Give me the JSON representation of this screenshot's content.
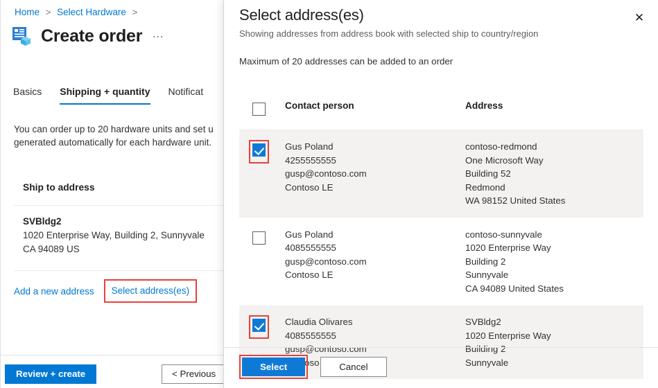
{
  "background_page": {
    "breadcrumb": {
      "home": "Home",
      "second": "Select Hardware",
      "separator": ">"
    },
    "title": "Create order",
    "more_label": "…",
    "tabs": [
      {
        "label": "Basics",
        "active": false
      },
      {
        "label": "Shipping + quantity",
        "active": true
      },
      {
        "label": "Notificat",
        "active": false
      }
    ],
    "body_line1": "You can order up to 20 hardware units and set u",
    "body_line2": "generated automatically for each hardware unit.",
    "section_heading": "Ship to address",
    "address": {
      "name": "SVBldg2",
      "line1": "1020 Enterprise Way, Building 2, Sunnyvale",
      "line2": "CA 94089 US"
    },
    "links": {
      "add_new_address": "Add a new address",
      "select_addresses": "Select address(es)"
    },
    "footer": {
      "review_create": "Review + create",
      "previous": "< Previous"
    }
  },
  "dialog": {
    "title": "Select address(es)",
    "subtitle": "Showing addresses from address book with selected ship to country/region",
    "note": "Maximum of 20 addresses can be added to an order",
    "close_label": "✕",
    "table": {
      "select_all_checked": false,
      "headers": {
        "contact_person": "Contact person",
        "address": "Address"
      },
      "rows": [
        {
          "checked": true,
          "highlighted": true,
          "contact": {
            "name": "Gus Poland",
            "phone": "4255555555",
            "email": "gusp@contoso.com",
            "company": "Contoso LE"
          },
          "address": {
            "label": "contoso-redmond",
            "street": "One Microsoft Way",
            "building": "Building 52",
            "city": "Redmond",
            "region": "WA 98152 United States"
          }
        },
        {
          "checked": false,
          "highlighted": false,
          "contact": {
            "name": "Gus Poland",
            "phone": "4085555555",
            "email": "gusp@contoso.com",
            "company": "Contoso LE"
          },
          "address": {
            "label": "contoso-sunnyvale",
            "street": "1020 Enterprise Way",
            "building": "Building 2",
            "city": "Sunnyvale",
            "region": "CA 94089 United States"
          }
        },
        {
          "checked": true,
          "highlighted": true,
          "contact": {
            "name": "Claudia Olivares",
            "phone": "4085555555",
            "email": "gusp@contoso.com",
            "company": "Contoso LE"
          },
          "address": {
            "label": "SVBldg2",
            "street": "1020 Enterprise Way",
            "building": "Building 2",
            "city": "Sunnyvale",
            "region": ""
          }
        }
      ]
    },
    "footer": {
      "select": "Select",
      "cancel": "Cancel"
    }
  },
  "colors": {
    "accent_blue": "#0078d4",
    "checkbox_blue": "#0f7ad6",
    "highlight_red": "#e8403a",
    "row_selected_bg": "#f3f2f1",
    "text_primary": "#201f1e",
    "text_secondary": "#605e5c"
  }
}
